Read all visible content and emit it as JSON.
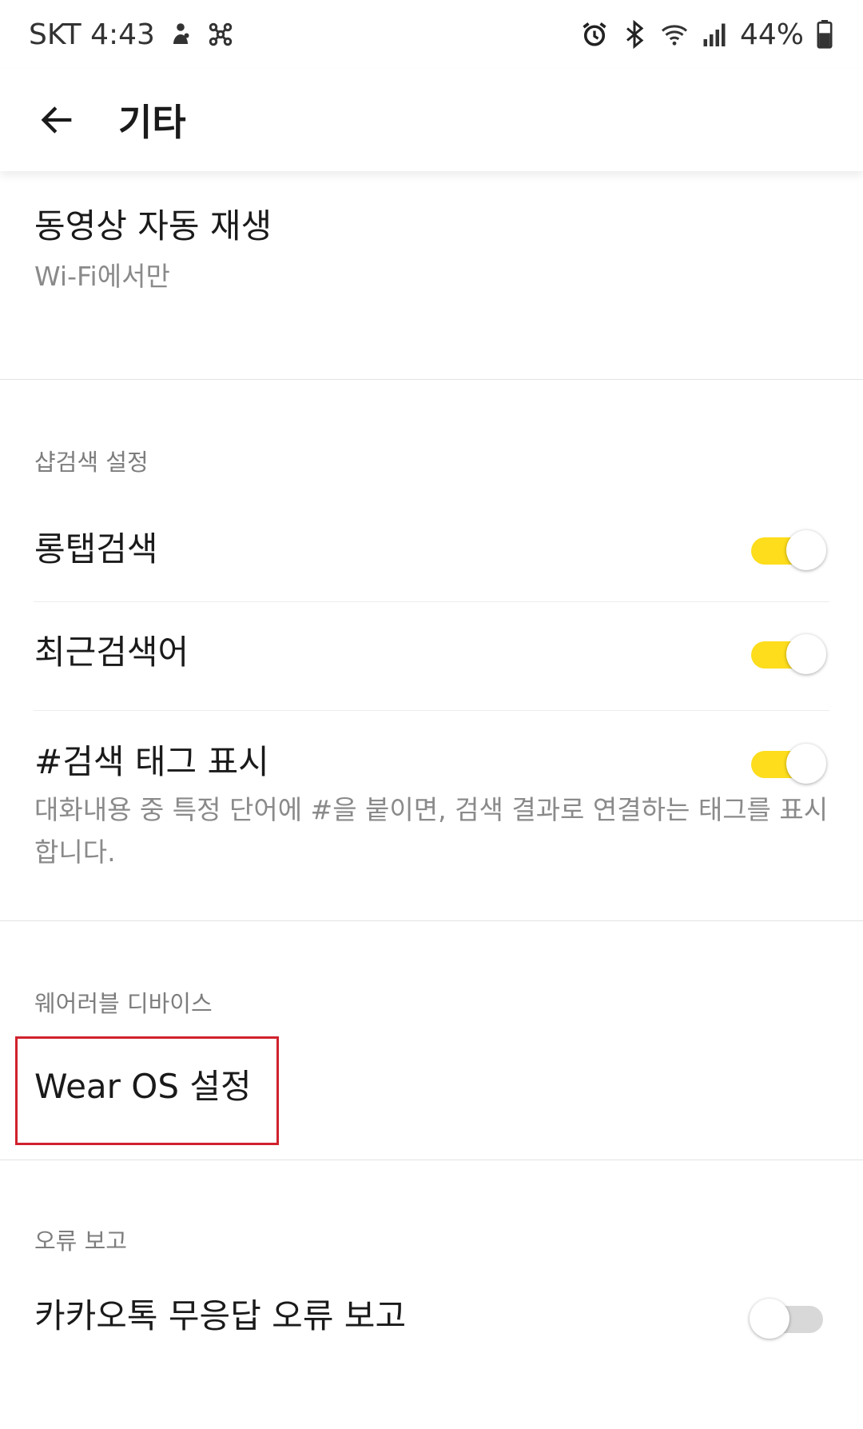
{
  "status_bar": {
    "carrier_time": "SKT 4:43",
    "battery_percent": "44%",
    "icons_left": [
      "person-notification-icon",
      "network-node-icon"
    ],
    "icons_right": [
      "alarm-icon",
      "bluetooth-icon",
      "wifi-icon",
      "signal-icon",
      "battery-icon"
    ]
  },
  "app_bar": {
    "title": "기타",
    "back_icon": "arrow-left-icon"
  },
  "settings": {
    "video_autoplay": {
      "title": "동영상 자동 재생",
      "value": "Wi-Fi에서만"
    },
    "sharp_search": {
      "header": "샵검색 설정",
      "long_tap": {
        "title": "롱탭검색",
        "enabled": true
      },
      "recent_keywords": {
        "title": "최근검색어",
        "enabled": true
      },
      "search_tag": {
        "title": "#검색 태그 표시",
        "enabled": true,
        "description": "대화내용 중 특정 단어에 #을 붙이면, 검색 결과로 연결하는 태그를 표시합니다."
      }
    },
    "wearable": {
      "header": "웨어러블 디바이스",
      "wear_os": {
        "title": "Wear OS 설정"
      }
    },
    "error_report": {
      "header": "오류 보고",
      "no_response": {
        "title": "카카오톡 무응답 오류 보고",
        "enabled": false
      }
    }
  },
  "colors": {
    "toggle_on": "#fddd1c",
    "toggle_off": "#d8d8d8",
    "highlight": "#d0222d"
  }
}
